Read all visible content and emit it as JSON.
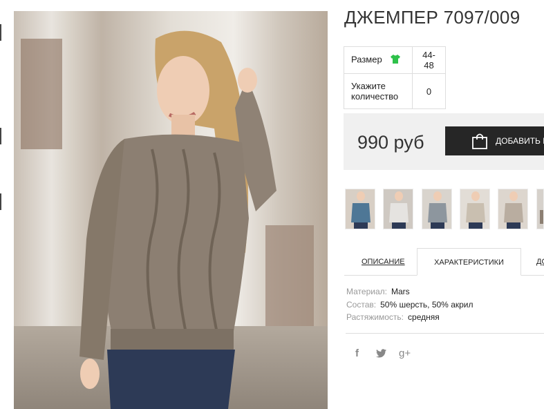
{
  "product": {
    "title": "ДЖЕМПЕР 7097/009"
  },
  "params": {
    "size_label": "Размер",
    "size_value": "44-48",
    "qty_label_1": "Укажите",
    "qty_label_2": "количество",
    "qty_value": "0",
    "size_icon": "tshirt-icon"
  },
  "price": {
    "value": "990 руб",
    "buy_label": "ДОБАВИТЬ В",
    "buy_icon": "shopping-bag-icon"
  },
  "colors": {
    "accent_green": "#2ec14a",
    "button_dark": "#262626",
    "price_bg": "#f0f0f0"
  },
  "thumbnails": [
    {
      "sweater": "#4e7796"
    },
    {
      "sweater": "#e5e3e0"
    },
    {
      "sweater": "#8d969e"
    },
    {
      "sweater": "#c9bfb0"
    },
    {
      "sweater": "#b9ada0"
    },
    {
      "sweater": "#d6d1cb"
    }
  ],
  "tabs": [
    {
      "label": "ОПИСАНИЕ"
    },
    {
      "label": "ХАРАКТЕРИСТИКИ"
    },
    {
      "label": "ДО"
    }
  ],
  "characteristics": [
    {
      "key": "Материал:",
      "value": "Mars"
    },
    {
      "key": "Состав:",
      "value": "50% шерсть, 50% акрил"
    },
    {
      "key": "Растяжимость:",
      "value": "средняя"
    }
  ],
  "social": {
    "facebook": "f",
    "twitter_icon": "twitter-icon",
    "gplus": "g+"
  }
}
